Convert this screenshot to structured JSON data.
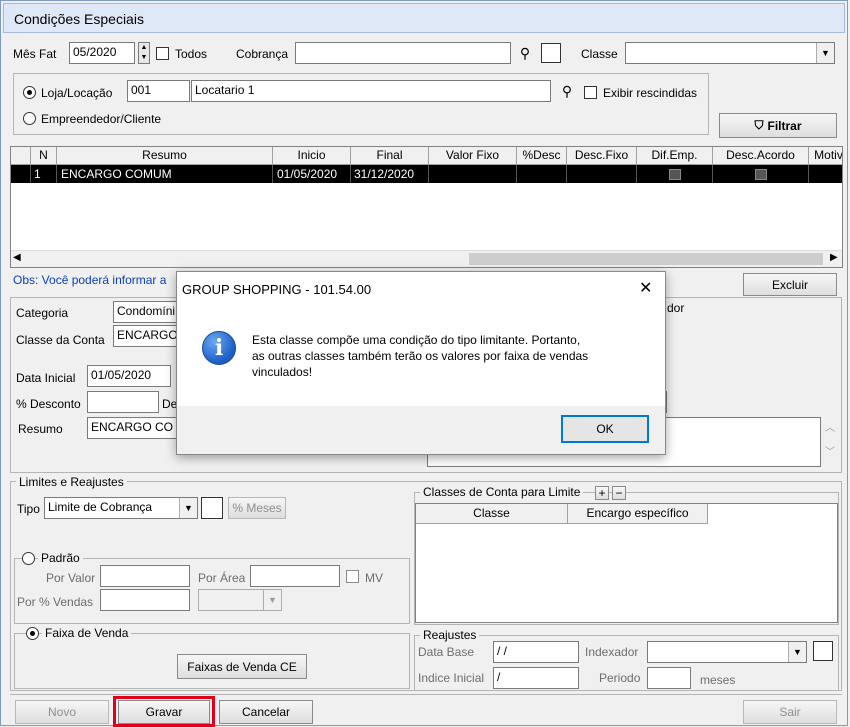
{
  "window": {
    "title": "Condições Especiais"
  },
  "filters": {
    "mes_fat_label": "Mês Fat",
    "mes_fat_value": "05/2020",
    "todos_label": "Todos",
    "cobranca_label": "Cobrança",
    "cobranca_value": "",
    "classe_label": "Classe",
    "classe_value": "",
    "loja_label": "Loja/Locação",
    "loja_code": "001",
    "loja_name": "Locatario 1",
    "exibir_label": "Exibir rescindidas",
    "empreendedor_label": "Empreendedor/Cliente",
    "filtrar_label": "Filtrar"
  },
  "grid": {
    "columns": [
      "N",
      "Resumo",
      "Inicio",
      "Final",
      "Valor Fixo",
      "%Desc",
      "Desc.Fixo",
      "Dif.Emp.",
      "Desc.Acordo",
      "Motiv"
    ],
    "rows": [
      {
        "n": "1",
        "resumo": "ENCARGO COMUM",
        "inicio": "01/05/2020",
        "final": "31/12/2020"
      }
    ]
  },
  "obs_text": "Obs: Você poderá informar a",
  "excluir_label": "Excluir",
  "detail": {
    "categoria_label": "Categoria",
    "categoria_value": "Condomíni",
    "classe_conta_label": "Classe da Conta",
    "classe_conta_value": "ENCARGO",
    "data_inicial_label": "Data Inicial",
    "data_inicial_value": "01/05/2020",
    "desconto_label": "% Desconto",
    "de_label": "De",
    "resumo_label": "Resumo",
    "resumo_value": "ENCARGO CO",
    "right_label_fragment": "dor"
  },
  "limites": {
    "group_title": "Limites e Reajustes",
    "tipo_label": "Tipo",
    "tipo_value": "Limite de Cobrança",
    "meses_label": "% Meses",
    "padrao_label": "Padrão",
    "por_valor_label": "Por Valor",
    "por_area_label": "Por Área",
    "mv_label": "MV",
    "por_vendas_label": "Por % Vendas",
    "faixa_label": "Faixa de Venda",
    "faixas_button": "Faixas de Venda CE"
  },
  "classes_conta": {
    "group_title": "Classes de Conta para Limite",
    "plus": "+",
    "minus": "−",
    "columns": [
      "Classe",
      "Encargo específico"
    ]
  },
  "reajustes": {
    "group_title": "Reajustes",
    "data_base_label": "Data Base",
    "data_base_value": " /  /",
    "indexador_label": "Indexador",
    "indice_label": "Indice Inicial",
    "indice_value": " /",
    "periodo_label": "Periodo",
    "meses_label": "meses"
  },
  "footer": {
    "novo": "Novo",
    "gravar": "Gravar",
    "cancelar": "Cancelar",
    "sair": "Sair"
  },
  "dialog": {
    "title": "GROUP SHOPPING - 101.54.00",
    "line1": "Esta classe compõe uma condição do tipo limitante. Portanto,",
    "line2": "as outras classes também terão os valores por faixa de vendas",
    "line3": "vinculados!",
    "ok": "OK",
    "close": "✕",
    "icon": "i"
  },
  "colors": {
    "highlight_border": "#e0001b",
    "selected_row": "#000000",
    "info_icon": "#1b5cc6"
  }
}
